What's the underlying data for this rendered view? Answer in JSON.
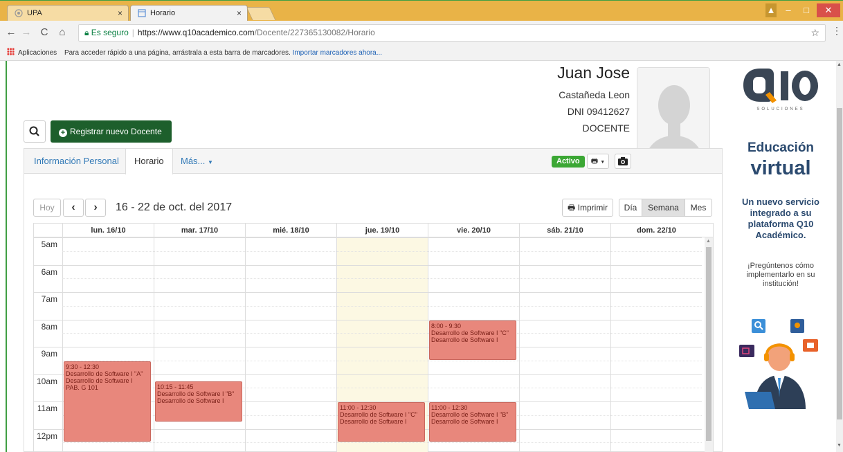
{
  "browser": {
    "tabs": [
      {
        "title": "UPA",
        "close": "×"
      },
      {
        "title": "Horario",
        "close": "×"
      }
    ],
    "window_controls": [
      "–",
      "□",
      "✕"
    ],
    "secure_label": "Es seguro",
    "url_host": "https://www.q10academico.com",
    "url_path": "/Docente/227365130082/Horario",
    "bookmarks_apps": "Aplicaciones",
    "bookmarks_hint": "Para acceder rápido a una página, arrástrala a esta barra de marcadores.",
    "bookmarks_import": "Importar marcadores ahora..."
  },
  "toolbar": {
    "register_label": "Registrar nuevo Docente"
  },
  "teacher": {
    "first_name": "Juan Jose",
    "last_name": "Castañeda Leon",
    "dni": "DNI 09412627",
    "role": "DOCENTE"
  },
  "panel": {
    "tabs": [
      "Información Personal",
      "Horario",
      "Más..."
    ],
    "active_tab": "Horario",
    "status_badge": "Activo"
  },
  "calendar": {
    "today_label": "Hoy",
    "prev": "‹",
    "next": "›",
    "range_title": "16 - 22 de oct. del 2017",
    "print_label": "Imprimir",
    "views": [
      "Día",
      "Semana",
      "Mes"
    ],
    "active_view": "Semana",
    "days": [
      "lun. 16/10",
      "mar. 17/10",
      "mié. 18/10",
      "jue. 19/10",
      "vie. 20/10",
      "sáb. 21/10",
      "dom. 22/10"
    ],
    "today_index": 3,
    "hours": [
      "5am",
      "6am",
      "7am",
      "8am",
      "9am",
      "10am",
      "11am",
      "12pm"
    ],
    "events": [
      {
        "day": 0,
        "start": 9.5,
        "end": 12.5,
        "lines": [
          "9:30 - 12:30",
          "Desarrollo de Software I \"A\"",
          "Desarrollo de Software I",
          "PAB. G 101"
        ]
      },
      {
        "day": 1,
        "start": 10.25,
        "end": 11.75,
        "lines": [
          "10:15 - 11:45",
          "Desarrollo de Software I \"B\"",
          "Desarrollo de Software I"
        ]
      },
      {
        "day": 3,
        "start": 11.0,
        "end": 12.5,
        "lines": [
          "11:00 - 12:30",
          "Desarrollo de Software I \"C\"",
          "Desarrollo de Software I"
        ]
      },
      {
        "day": 4,
        "start": 8.0,
        "end": 9.5,
        "lines": [
          "8:00 - 9:30",
          "Desarrollo de Software I \"C\"",
          "Desarrollo de Software I"
        ]
      },
      {
        "day": 4,
        "start": 11.0,
        "end": 12.5,
        "lines": [
          "11:00 - 12:30",
          "Desarrollo de Software I \"B\"",
          "Desarrollo de Software I"
        ]
      }
    ]
  },
  "ad": {
    "logo_sub": "SOLUCIONES",
    "title1": "Educación",
    "title2": "virtual",
    "text": "Un nuevo servicio integrado a su plataforma Q10 Académico.",
    "text2": "¡Pregúntenos cómo implementarlo en su institución!",
    "colors": {
      "brand_blue": "#2b4a6f",
      "brand_orange": "#f39200"
    }
  },
  "colors": {
    "event_fill": "#e8877c",
    "today_fill": "#fcf8e3",
    "register_button": "#1d5f2c",
    "status_green": "#3ba734"
  }
}
